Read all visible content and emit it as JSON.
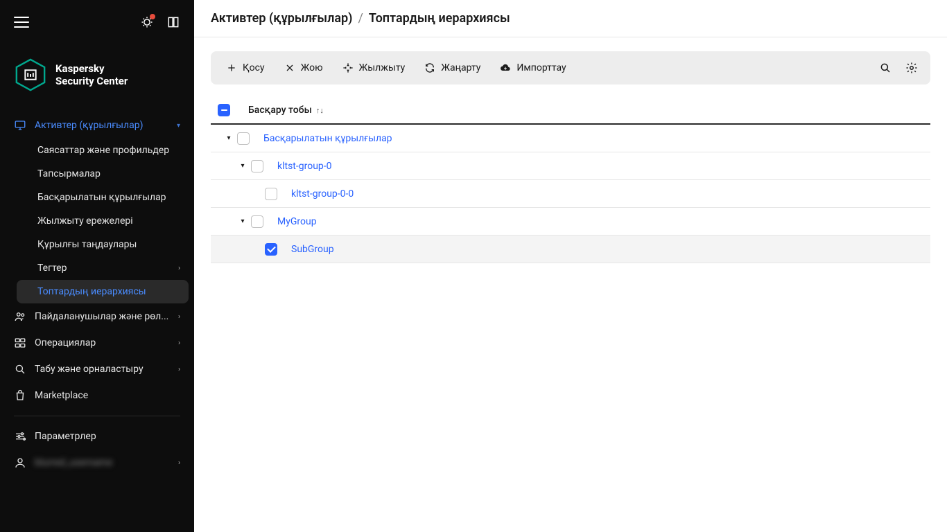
{
  "app": {
    "name_line1": "Kaspersky",
    "name_line2": "Security Center"
  },
  "breadcrumb": {
    "parent": "Активтер (құрылғылар)",
    "sep": "/",
    "current": "Топтардың иерархиясы"
  },
  "sidebar": {
    "items": [
      {
        "label": "Активтер (құрылғылар)",
        "active": true,
        "expandable": true
      },
      {
        "label": "Пайдаланушылар және рөл...",
        "expandable": true
      },
      {
        "label": "Операциялар",
        "expandable": true
      },
      {
        "label": "Табу және орналастыру",
        "expandable": true
      },
      {
        "label": "Marketplace",
        "expandable": false
      }
    ],
    "assets_sub": [
      {
        "label": "Саясаттар және профильдер"
      },
      {
        "label": "Тапсырмалар"
      },
      {
        "label": "Басқарылатын құрылғылар"
      },
      {
        "label": "Жылжыту ережелері"
      },
      {
        "label": "Құрылғы таңдаулары"
      },
      {
        "label": "Тегтер",
        "expandable": true
      },
      {
        "label": "Топтардың иерархиясы",
        "selected": true
      }
    ],
    "bottom": [
      {
        "label": "Параметрлер"
      },
      {
        "label": "blurred_username",
        "blur": true,
        "expandable": true
      }
    ]
  },
  "toolbar": {
    "add": "Қосу",
    "delete": "Жою",
    "move": "Жылжыту",
    "refresh": "Жаңарту",
    "import": "Импорттау"
  },
  "table": {
    "header": "Басқару тобы",
    "rows": [
      {
        "label": "Басқарылатын құрылғылар",
        "indent": 0,
        "caret": true,
        "checked": false
      },
      {
        "label": "kltst-group-0",
        "indent": 1,
        "caret": true,
        "checked": false
      },
      {
        "label": "kltst-group-0-0",
        "indent": 2,
        "caret": false,
        "checked": false
      },
      {
        "label": "MyGroup",
        "indent": 1,
        "caret": true,
        "checked": false
      },
      {
        "label": "SubGroup",
        "indent": 2,
        "caret": false,
        "checked": true,
        "selected": true
      }
    ]
  }
}
